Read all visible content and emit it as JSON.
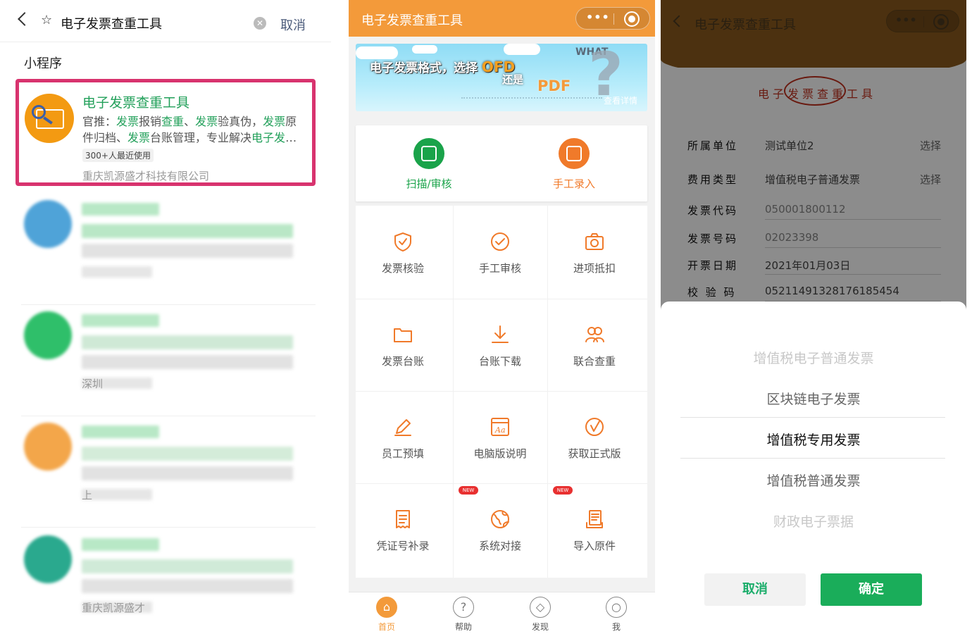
{
  "panel1": {
    "search_query": "电子发票查重工具",
    "cancel_label": "取消",
    "section_label": "小程序",
    "result": {
      "title": "电子发票查重工具",
      "desc_parts": [
        {
          "t": "官推：",
          "g": false
        },
        {
          "t": "发票",
          "g": true
        },
        {
          "t": "报销",
          "g": false
        },
        {
          "t": "查重",
          "g": true
        },
        {
          "t": "、",
          "g": false
        },
        {
          "t": "发票",
          "g": true
        },
        {
          "t": "验真伪，",
          "g": false
        },
        {
          "t": "发票",
          "g": true
        },
        {
          "t": "原件归档、",
          "g": false
        },
        {
          "t": "发票",
          "g": true
        },
        {
          "t": "台账管理，专业解决",
          "g": false
        },
        {
          "t": "电子发",
          "g": true
        },
        {
          "t": "…",
          "g": false
        }
      ],
      "users_badge": "300+人最近使用",
      "company": "重庆凯源盛才科技有限公司"
    },
    "blurred_results": [
      {
        "glyph": "",
        "color": "#4fa3d8",
        "foot": "",
        "line_color": "#b9e7c6"
      },
      {
        "glyph": "",
        "color": "#2fbf6a",
        "foot": "深圳",
        "line_color": "#cfe9d6"
      },
      {
        "glyph": "",
        "color": "#f3a64a",
        "foot": "上",
        "line_color": "#d4ecd9"
      },
      {
        "glyph": "",
        "color": "#2aa98e",
        "foot": "重庆凯源盛才",
        "line_color": "#d0ead8"
      }
    ]
  },
  "panel2": {
    "title": "电子发票查重工具",
    "banner": {
      "line1_a": "电子发票格式，选择",
      "line1_b": "OFD",
      "line2": "还是",
      "pdf": "PDF",
      "what": "WHAT",
      "more": "查看详情"
    },
    "quick_actions": [
      {
        "label": "扫描/审核",
        "color": "#1aa34a"
      },
      {
        "label": "手工录入",
        "color": "#f07a2a"
      }
    ],
    "grid": [
      {
        "label": "发票核验",
        "icon": "shield-check-icon",
        "new": false
      },
      {
        "label": "手工审核",
        "icon": "check-circle-icon",
        "new": false
      },
      {
        "label": "进项抵扣",
        "icon": "camera-icon",
        "new": false
      },
      {
        "label": "发票台账",
        "icon": "folder-icon",
        "new": false
      },
      {
        "label": "台账下载",
        "icon": "download-icon",
        "new": false
      },
      {
        "label": "联合查重",
        "icon": "users-icon",
        "new": false
      },
      {
        "label": "员工预填",
        "icon": "pencil-icon",
        "new": false
      },
      {
        "label": "电脑版说明",
        "icon": "font-doc-icon",
        "new": false
      },
      {
        "label": "获取正式版",
        "icon": "check-version-icon",
        "new": false
      },
      {
        "label": "凭证号补录",
        "icon": "receipt-icon",
        "new": false
      },
      {
        "label": "系统对接",
        "icon": "globe-icon",
        "new": true
      },
      {
        "label": "导入原件",
        "icon": "import-docs-icon",
        "new": true
      }
    ],
    "new_badge": "NEW",
    "tabs": [
      {
        "label": "首页",
        "icon": "home-icon",
        "active": true
      },
      {
        "label": "帮助",
        "icon": "help-icon",
        "active": false
      },
      {
        "label": "发现",
        "icon": "gift-icon",
        "active": false
      },
      {
        "label": "我",
        "icon": "user-icon",
        "active": false
      }
    ]
  },
  "panel3": {
    "title": "电子发票查重工具",
    "paper_title": "电子发票查重工具",
    "fields": [
      {
        "key": "所属单位",
        "value": "测试单位2",
        "select": "选择",
        "ph": false
      },
      {
        "key": "费用类型",
        "value": "增值税电子普通发票",
        "select": "选择",
        "ph": false
      },
      {
        "key": "发票代码",
        "value": "050001800112",
        "select": "",
        "ph": true
      },
      {
        "key": "发票号码",
        "value": "02023398",
        "select": "",
        "ph": true
      },
      {
        "key": "开票日期",
        "value": "2021年01月03日",
        "select": "",
        "ph": false
      },
      {
        "key": "校 验 码",
        "value": "05211491328176185454",
        "select": "",
        "ph": false
      }
    ],
    "picker_options": [
      {
        "label": "增值税电子普通发票",
        "level": 2
      },
      {
        "label": "区块链电子发票",
        "level": 1
      },
      {
        "label": "增值税专用发票",
        "level": 0
      },
      {
        "label": "增值税普通发票",
        "level": 1
      },
      {
        "label": "财政电子票据",
        "level": 2
      }
    ],
    "cancel_label": "取消",
    "confirm_label": "确定"
  }
}
